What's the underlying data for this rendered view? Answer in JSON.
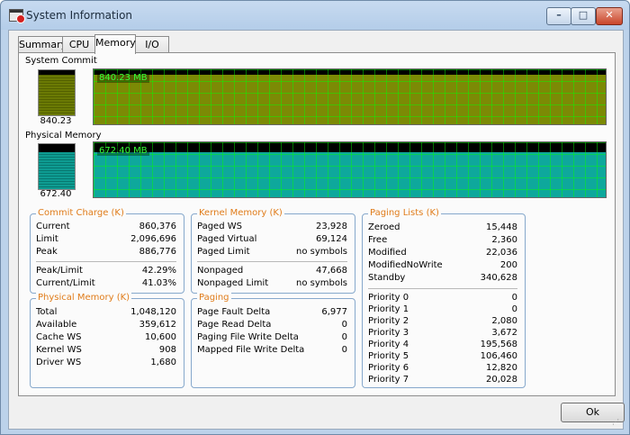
{
  "window": {
    "title": "System Information"
  },
  "tabs": [
    {
      "label": "Summary"
    },
    {
      "label": "CPU"
    },
    {
      "label": "Memory"
    },
    {
      "label": "I/O"
    }
  ],
  "system_commit": {
    "label": "System Commit",
    "value": "840.23",
    "graph_label": "840.23 MB",
    "level": 0.91,
    "color": "#7c8a05"
  },
  "physical_memory_graph": {
    "label": "Physical Memory",
    "value": "672.40",
    "graph_label": "672.40 MB",
    "level": 0.82,
    "color": "#0ea89c"
  },
  "commit_charge": {
    "title": "Commit Charge (K)",
    "rows": [
      {
        "key": "Current",
        "value": "860,376"
      },
      {
        "key": "Limit",
        "value": "2,096,696"
      },
      {
        "key": "Peak",
        "value": "886,776"
      }
    ],
    "rows2": [
      {
        "key": "Peak/Limit",
        "value": "42.29%"
      },
      {
        "key": "Current/Limit",
        "value": "41.03%"
      }
    ]
  },
  "physical_memory": {
    "title": "Physical Memory (K)",
    "rows": [
      {
        "key": "Total",
        "value": "1,048,120"
      },
      {
        "key": "Available",
        "value": "359,612"
      },
      {
        "key": "Cache WS",
        "value": "10,600"
      },
      {
        "key": "Kernel WS",
        "value": "908"
      },
      {
        "key": "Driver WS",
        "value": "1,680"
      }
    ]
  },
  "kernel_memory": {
    "title": "Kernel Memory (K)",
    "rows": [
      {
        "key": "Paged WS",
        "value": "23,928"
      },
      {
        "key": "Paged Virtual",
        "value": "69,124"
      },
      {
        "key": "Paged Limit",
        "value": "no symbols"
      }
    ],
    "rows2": [
      {
        "key": "Nonpaged",
        "value": "47,668"
      },
      {
        "key": "Nonpaged Limit",
        "value": "no symbols"
      }
    ]
  },
  "paging": {
    "title": "Paging",
    "rows": [
      {
        "key": "Page Fault Delta",
        "value": "6,977"
      },
      {
        "key": "Page Read Delta",
        "value": "0"
      },
      {
        "key": "Paging File Write Delta",
        "value": "0"
      },
      {
        "key": "Mapped File Write Delta",
        "value": "0"
      }
    ]
  },
  "paging_lists": {
    "title": "Paging Lists (K)",
    "rows": [
      {
        "key": "Zeroed",
        "value": "15,448"
      },
      {
        "key": "Free",
        "value": "2,360"
      },
      {
        "key": "Modified",
        "value": "22,036"
      },
      {
        "key": "ModifiedNoWrite",
        "value": "200"
      },
      {
        "key": "Standby",
        "value": "340,628"
      }
    ],
    "rows2": [
      {
        "key": "Priority 0",
        "value": "0"
      },
      {
        "key": "Priority 1",
        "value": "0"
      },
      {
        "key": "Priority 2",
        "value": "2,080"
      },
      {
        "key": "Priority 3",
        "value": "3,672"
      },
      {
        "key": "Priority 4",
        "value": "195,568"
      },
      {
        "key": "Priority 5",
        "value": "106,460"
      },
      {
        "key": "Priority 6",
        "value": "12,820"
      },
      {
        "key": "Priority 7",
        "value": "20,028"
      }
    ]
  },
  "ok_label": "Ok"
}
